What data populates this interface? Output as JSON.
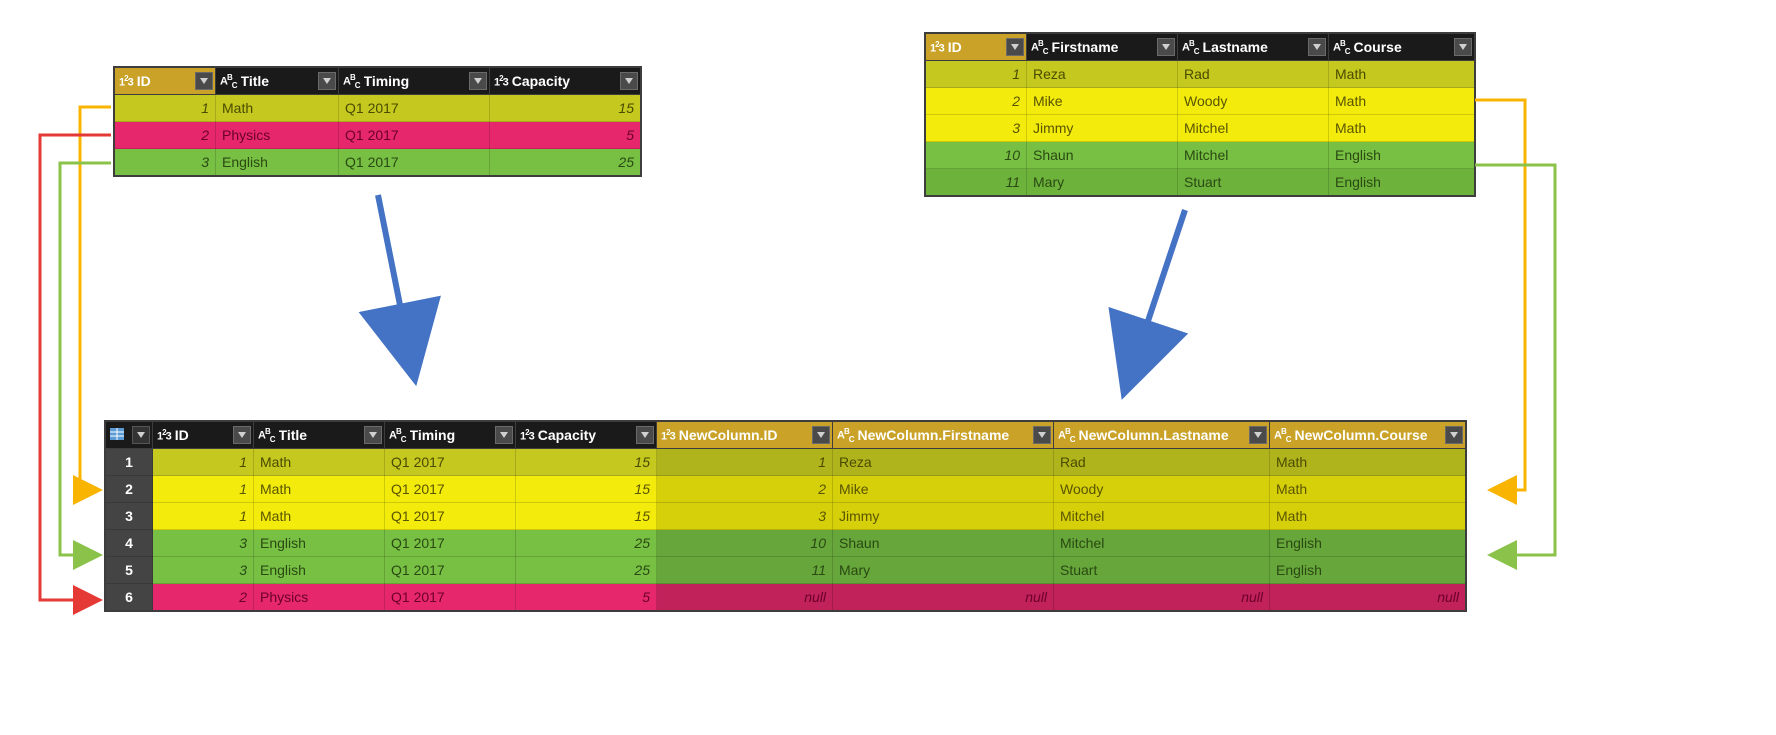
{
  "icons": {
    "num_type": "1²3",
    "text_type": "AᴮC"
  },
  "colors": {
    "yellow": "#f2eb0c",
    "olive": "#c4c81f",
    "green": "#77c043",
    "pink": "#e6276c",
    "header_sel": "#c9a227",
    "arrow_blue": "#4472c4",
    "conn_yellow": "#f8b400",
    "conn_green": "#8bc34a",
    "conn_red": "#e53935"
  },
  "tableA": {
    "columns": [
      {
        "name": "ID",
        "type": "num",
        "selected": true
      },
      {
        "name": "Title",
        "type": "text",
        "selected": false
      },
      {
        "name": "Timing",
        "type": "text",
        "selected": false
      },
      {
        "name": "Capacity",
        "type": "num",
        "selected": false
      }
    ],
    "widths": [
      100,
      122,
      150,
      150
    ],
    "rows": [
      {
        "cls": "row-olive",
        "cells": [
          {
            "v": "1",
            "t": "num"
          },
          {
            "v": "Math"
          },
          {
            "v": "Q1 2017"
          },
          {
            "v": "15",
            "t": "num"
          }
        ]
      },
      {
        "cls": "row-pink",
        "cells": [
          {
            "v": "2",
            "t": "num"
          },
          {
            "v": "Physics"
          },
          {
            "v": "Q1 2017"
          },
          {
            "v": "5",
            "t": "num"
          }
        ]
      },
      {
        "cls": "row-green",
        "cells": [
          {
            "v": "3",
            "t": "num"
          },
          {
            "v": "English"
          },
          {
            "v": "Q1 2017"
          },
          {
            "v": "25",
            "t": "num"
          }
        ]
      }
    ]
  },
  "tableB": {
    "columns": [
      {
        "name": "ID",
        "type": "num",
        "selected": true
      },
      {
        "name": "Firstname",
        "type": "text",
        "selected": false
      },
      {
        "name": "Lastname",
        "type": "text",
        "selected": false
      },
      {
        "name": "Course",
        "type": "text",
        "selected": false
      }
    ],
    "widths": [
      100,
      150,
      150,
      145
    ],
    "rows": [
      {
        "cls": "row-olive",
        "cells": [
          {
            "v": "1",
            "t": "num"
          },
          {
            "v": "Reza"
          },
          {
            "v": "Rad"
          },
          {
            "v": "Math"
          }
        ]
      },
      {
        "cls": "row-yellow",
        "cells": [
          {
            "v": "2",
            "t": "num"
          },
          {
            "v": "Mike"
          },
          {
            "v": "Woody"
          },
          {
            "v": "Math"
          }
        ]
      },
      {
        "cls": "row-yellow",
        "cells": [
          {
            "v": "3",
            "t": "num"
          },
          {
            "v": "Jimmy"
          },
          {
            "v": "Mitchel"
          },
          {
            "v": "Math"
          }
        ]
      },
      {
        "cls": "row-green",
        "cells": [
          {
            "v": "10",
            "t": "num"
          },
          {
            "v": "Shaun"
          },
          {
            "v": "Mitchel"
          },
          {
            "v": "English"
          }
        ]
      },
      {
        "cls": "row-greenb",
        "cells": [
          {
            "v": "11",
            "t": "num"
          },
          {
            "v": "Mary"
          },
          {
            "v": "Stuart"
          },
          {
            "v": "English"
          }
        ]
      }
    ]
  },
  "tableC": {
    "columns": [
      {
        "name": "",
        "type": "rowhdr",
        "selected": false
      },
      {
        "name": "ID",
        "type": "num",
        "selected": false
      },
      {
        "name": "Title",
        "type": "text",
        "selected": false
      },
      {
        "name": "Timing",
        "type": "text",
        "selected": false
      },
      {
        "name": "Capacity",
        "type": "num",
        "selected": false
      },
      {
        "name": "NewColumn.ID",
        "type": "num",
        "selected": true
      },
      {
        "name": "NewColumn.Firstname",
        "type": "text",
        "selected": true
      },
      {
        "name": "NewColumn.Lastname",
        "type": "text",
        "selected": true
      },
      {
        "name": "NewColumn.Course",
        "type": "text",
        "selected": true
      }
    ],
    "widths": [
      34,
      100,
      130,
      130,
      140,
      175,
      220,
      215,
      195
    ],
    "rows": [
      {
        "n": "1",
        "clsL": "row-olive",
        "clsR": "row-olive-dim",
        "cells": [
          {
            "v": "1",
            "t": "num"
          },
          {
            "v": "Math"
          },
          {
            "v": "Q1 2017"
          },
          {
            "v": "15",
            "t": "num"
          },
          {
            "v": "1",
            "t": "num"
          },
          {
            "v": "Reza"
          },
          {
            "v": "Rad"
          },
          {
            "v": "Math"
          }
        ]
      },
      {
        "n": "2",
        "clsL": "row-yellow",
        "clsR": "row-yellow-dim",
        "cells": [
          {
            "v": "1",
            "t": "num"
          },
          {
            "v": "Math"
          },
          {
            "v": "Q1 2017"
          },
          {
            "v": "15",
            "t": "num"
          },
          {
            "v": "2",
            "t": "num"
          },
          {
            "v": "Mike"
          },
          {
            "v": "Woody"
          },
          {
            "v": "Math"
          }
        ]
      },
      {
        "n": "3",
        "clsL": "row-yellow",
        "clsR": "row-yellow-dim",
        "cells": [
          {
            "v": "1",
            "t": "num"
          },
          {
            "v": "Math"
          },
          {
            "v": "Q1 2017"
          },
          {
            "v": "15",
            "t": "num"
          },
          {
            "v": "3",
            "t": "num"
          },
          {
            "v": "Jimmy"
          },
          {
            "v": "Mitchel"
          },
          {
            "v": "Math"
          }
        ]
      },
      {
        "n": "4",
        "clsL": "row-green",
        "clsR": "row-green-dim",
        "cells": [
          {
            "v": "3",
            "t": "num"
          },
          {
            "v": "English"
          },
          {
            "v": "Q1 2017"
          },
          {
            "v": "25",
            "t": "num"
          },
          {
            "v": "10",
            "t": "num"
          },
          {
            "v": "Shaun"
          },
          {
            "v": "Mitchel"
          },
          {
            "v": "English"
          }
        ]
      },
      {
        "n": "5",
        "clsL": "row-green",
        "clsR": "row-green-dim",
        "cells": [
          {
            "v": "3",
            "t": "num"
          },
          {
            "v": "English"
          },
          {
            "v": "Q1 2017"
          },
          {
            "v": "25",
            "t": "num"
          },
          {
            "v": "11",
            "t": "num"
          },
          {
            "v": "Mary"
          },
          {
            "v": "Stuart"
          },
          {
            "v": "English"
          }
        ]
      },
      {
        "n": "6",
        "clsL": "row-pink",
        "clsR": "row-pink-dim",
        "cells": [
          {
            "v": "2",
            "t": "num"
          },
          {
            "v": "Physics"
          },
          {
            "v": "Q1 2017"
          },
          {
            "v": "5",
            "t": "num"
          },
          {
            "v": "null",
            "t": "nullv"
          },
          {
            "v": "null",
            "t": "nullv"
          },
          {
            "v": "null",
            "t": "nullv"
          },
          {
            "v": "null",
            "t": "nullv"
          }
        ]
      }
    ]
  },
  "null_text": "null"
}
